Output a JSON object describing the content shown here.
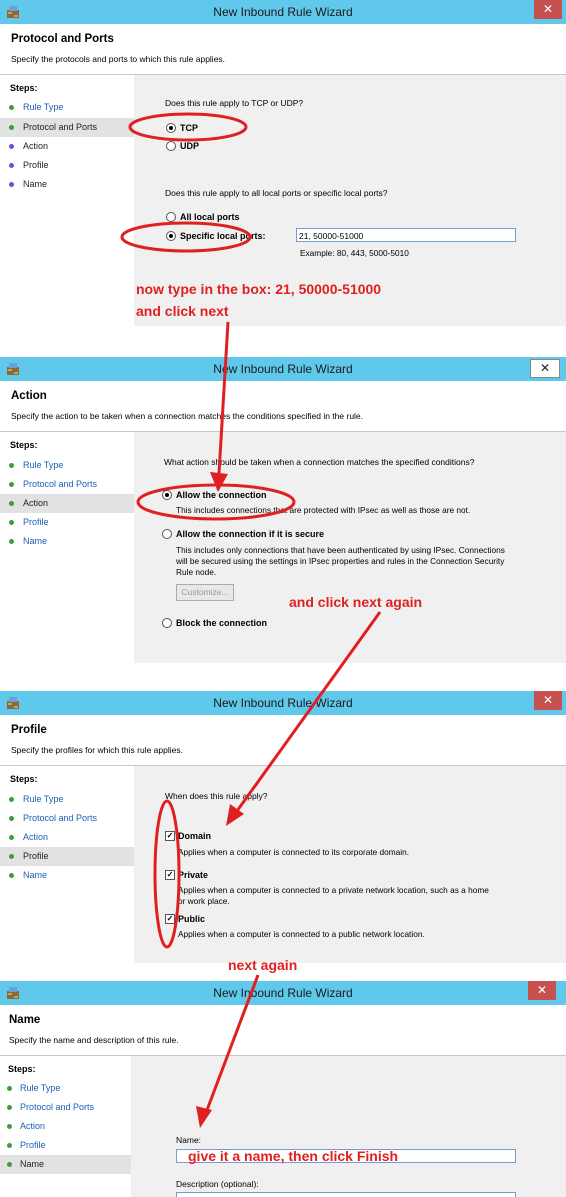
{
  "wizard_title": "New Inbound Rule Wizard",
  "close_glyph": "✕",
  "steps_header": "Steps:",
  "panels": {
    "protocol": {
      "heading": "Protocol and Ports",
      "description": "Specify the protocols and ports to which this rule applies.",
      "steps": [
        "Rule Type",
        "Protocol and Ports",
        "Action",
        "Profile",
        "Name"
      ],
      "q1": "Does this rule apply to TCP or UDP?",
      "tcp": "TCP",
      "udp": "UDP",
      "q2": "Does this rule apply to all local ports or specific local ports?",
      "all_ports": "All local ports",
      "specific_ports": "Specific local ports:",
      "ports_value": "21, 50000-51000",
      "ports_example": "Example: 80, 443, 5000-5010"
    },
    "action": {
      "heading": "Action",
      "description": "Specify the action to be taken when a connection matches the conditions specified in the rule.",
      "steps": [
        "Rule Type",
        "Protocol and Ports",
        "Action",
        "Profile",
        "Name"
      ],
      "q": "What action should be taken when a connection matches the specified conditions?",
      "allow": "Allow the connection",
      "allow_desc": "This includes connections that are protected with IPsec as well as those are not.",
      "allow_secure": "Allow the connection if it is secure",
      "allow_secure_desc1": "This includes only connections that have been authenticated by using IPsec.  Connections",
      "allow_secure_desc2": "will be secured using the settings in IPsec properties and rules in the Connection Security",
      "allow_secure_desc3": "Rule node.",
      "customize": "Customize...",
      "block": "Block the connection"
    },
    "profile": {
      "heading": "Profile",
      "description": "Specify the profiles for which this rule applies.",
      "steps": [
        "Rule Type",
        "Protocol and Ports",
        "Action",
        "Profile",
        "Name"
      ],
      "q": "When does this rule apply?",
      "domain": "Domain",
      "domain_desc": "Applies when a computer is connected to its corporate domain.",
      "private": "Private",
      "private_desc1": "Applies when a computer is connected to a private network location, such as a home",
      "private_desc2": "or work place.",
      "public": "Public",
      "public_desc": "Applies when a computer is connected to a public network location."
    },
    "name": {
      "heading": "Name",
      "description": "Specify the name and description of this rule.",
      "steps": [
        "Rule Type",
        "Protocol and Ports",
        "Action",
        "Profile",
        "Name"
      ],
      "name_label": "Name:",
      "desc_label": "Description (optional):"
    }
  },
  "annotations": {
    "a1_line1": "now type in the box:     21, 50000-51000",
    "a1_line2": "and click next",
    "a2": "and click next again",
    "a3": "next again",
    "a4": "give it a name, then click Finish"
  },
  "colors": {
    "titlebar": "#60c8ea",
    "annotation": "#e02020",
    "close_red": "#c75050"
  }
}
